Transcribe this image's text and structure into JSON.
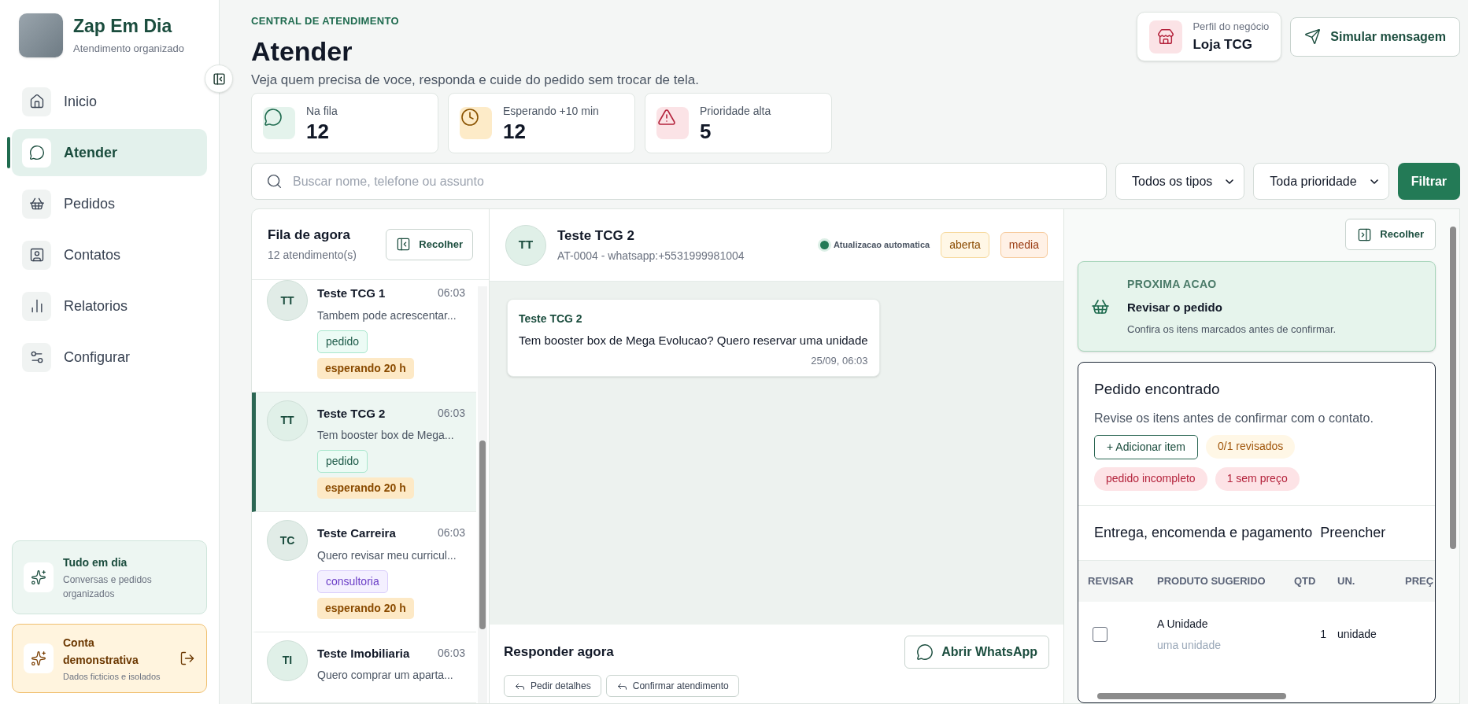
{
  "brand": {
    "name": "Zap Em Dia",
    "tagline": "Atendimento organizado"
  },
  "nav": [
    {
      "label": "Inicio",
      "selected": false
    },
    {
      "label": "Atender",
      "selected": true
    },
    {
      "label": "Pedidos",
      "selected": false
    },
    {
      "label": "Contatos",
      "selected": false
    },
    {
      "label": "Relatorios",
      "selected": false
    },
    {
      "label": "Configurar",
      "selected": false
    }
  ],
  "status_cards": [
    {
      "kind": "ok",
      "title": "Tudo em dia",
      "subtitle": "Conversas e pedidos organizados"
    },
    {
      "kind": "demo",
      "title": "Conta demonstrativa",
      "subtitle": "Dados ficticios e isolados"
    }
  ],
  "header": {
    "eyebrow": "CENTRAL DE ATENDIMENTO",
    "title": "Atender",
    "subtitle": "Veja quem precisa de voce, responda e cuide do pedido sem trocar de tela."
  },
  "business": {
    "label": "Perfil do negócio",
    "name": "Loja TCG"
  },
  "simulate_button": "Simular mensagem",
  "stats": [
    {
      "kind": "green",
      "label": "Na fila",
      "value": "12"
    },
    {
      "kind": "amber",
      "label": "Esperando +10 min",
      "value": "12"
    },
    {
      "kind": "red",
      "label": "Prioridade alta",
      "value": "5"
    }
  ],
  "search": {
    "placeholder": "Buscar nome, telefone ou assunto"
  },
  "filters": [
    {
      "value": "Todos os tipos"
    },
    {
      "value": "Toda prioridade"
    }
  ],
  "filter_button": "Filtrar",
  "queue": {
    "title": "Fila de agora",
    "count": "12 atendimento(s)",
    "collapse_button": "Recolher",
    "items": [
      {
        "initials": "TT",
        "name": "Teste TCG 1",
        "time": "06:03",
        "preview": "Tambem pode acrescentar...",
        "selected": false,
        "tags": [
          {
            "kind": "green",
            "label": "pedido"
          },
          {
            "kind": "wait",
            "label": "esperando 20 h"
          }
        ]
      },
      {
        "initials": "TT",
        "name": "Teste TCG 2",
        "time": "06:03",
        "preview": "Tem booster box de Mega...",
        "selected": true,
        "tags": [
          {
            "kind": "green",
            "label": "pedido"
          },
          {
            "kind": "wait",
            "label": "esperando 20 h"
          }
        ]
      },
      {
        "initials": "TC",
        "name": "Teste Carreira",
        "time": "06:03",
        "preview": "Quero revisar meu curricul...",
        "selected": false,
        "tags": [
          {
            "kind": "purple",
            "label": "consultoria"
          },
          {
            "kind": "wait",
            "label": "esperando 20 h"
          }
        ]
      },
      {
        "initials": "TI",
        "name": "Teste Imobiliaria",
        "time": "06:03",
        "preview": "Quero comprar um aparta...",
        "selected": false
      }
    ]
  },
  "chat": {
    "initials": "TT",
    "name": "Teste TCG 2",
    "subtitle": "AT-0004 - whatsapp:+5531999981004",
    "live_label": "Atualizacao automatica",
    "badges": [
      {
        "kind": "amber",
        "label": "aberta"
      },
      {
        "kind": "orange",
        "label": "media"
      }
    ],
    "messages": [
      {
        "sender": "Teste TCG 2",
        "text": "Tem booster box de Mega Evolucao? Quero reservar uma unidade",
        "time": "25/09, 06:03"
      }
    ],
    "reply_title": "Responder agora",
    "open_button": "Abrir WhatsApp",
    "quick_replies": [
      "Pedir detalhes",
      "Confirmar atendimento"
    ]
  },
  "side": {
    "collapse_button": "Recolher",
    "next_action": {
      "eyebrow": "PROXIMA ACAO",
      "title": "Revisar o pedido",
      "text": "Confira os itens marcados antes de confirmar."
    },
    "order": {
      "title": "Pedido encontrado",
      "subtitle": "Revise os itens antes de confirmar com o contato.",
      "add_button": "+ Adicionar item",
      "badges": [
        {
          "kind": "amber",
          "label": "0/1 revisados"
        },
        {
          "kind": "red",
          "label": "pedido incompleto"
        },
        {
          "kind": "red",
          "label": "1 sem preço"
        }
      ],
      "delivery_title": "Entrega, encomenda e pagamento",
      "delivery_action": "Preencher",
      "columns": [
        "REVISAR",
        "PRODUTO SUGERIDO",
        "QTD",
        "UN.",
        "PREÇ"
      ],
      "rows": [
        {
          "checked": false,
          "product": "A Unidade",
          "note": "uma unidade",
          "qty": "1",
          "unit": "unidade"
        }
      ]
    }
  }
}
